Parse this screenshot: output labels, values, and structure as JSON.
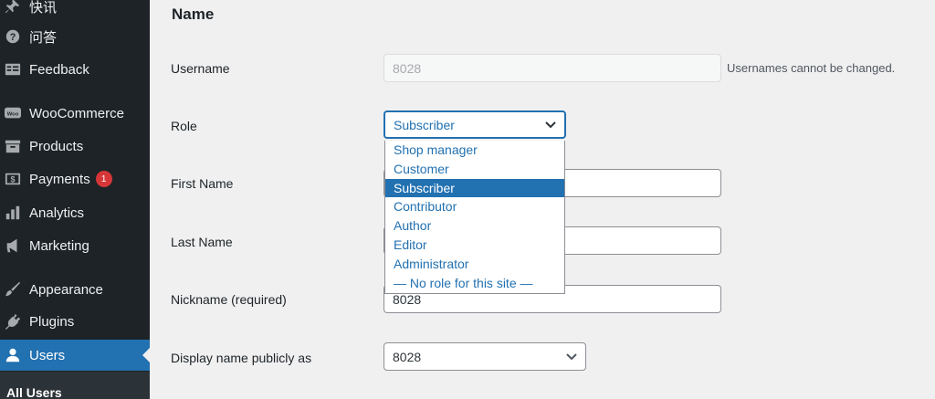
{
  "sidebar": {
    "items": [
      {
        "label": "快讯",
        "icon": "pin-icon"
      },
      {
        "label": "问答",
        "icon": "help-icon"
      },
      {
        "label": "Feedback",
        "icon": "feedback-icon"
      },
      {
        "label": "WooCommerce",
        "icon": "woocommerce-icon"
      },
      {
        "label": "Products",
        "icon": "archive-icon"
      },
      {
        "label": "Payments",
        "icon": "money-icon",
        "badge": "1"
      },
      {
        "label": "Analytics",
        "icon": "chart-bar-icon"
      },
      {
        "label": "Marketing",
        "icon": "megaphone-icon"
      },
      {
        "label": "Appearance",
        "icon": "brush-icon"
      },
      {
        "label": "Plugins",
        "icon": "plugin-icon"
      },
      {
        "label": "Users",
        "icon": "users-icon"
      }
    ],
    "submenu": {
      "label": "All Users"
    }
  },
  "form": {
    "section_title": "Name",
    "username": {
      "label": "Username",
      "value": "8028",
      "description": "Usernames cannot be changed."
    },
    "role": {
      "label": "Role",
      "selected": "Subscriber",
      "options": [
        "Shop manager",
        "Customer",
        "Subscriber",
        "Contributor",
        "Author",
        "Editor",
        "Administrator",
        "— No role for this site —"
      ]
    },
    "first_name": {
      "label": "First Name",
      "value": ""
    },
    "last_name": {
      "label": "Last Name",
      "value": ""
    },
    "nickname": {
      "label": "Nickname (required)",
      "value": "8028"
    },
    "display_name": {
      "label": "Display name publicly as",
      "value": "8028"
    }
  },
  "colors": {
    "accent": "#2271b1",
    "sidebar_bg": "#1d2327",
    "badge": "#d63638"
  }
}
